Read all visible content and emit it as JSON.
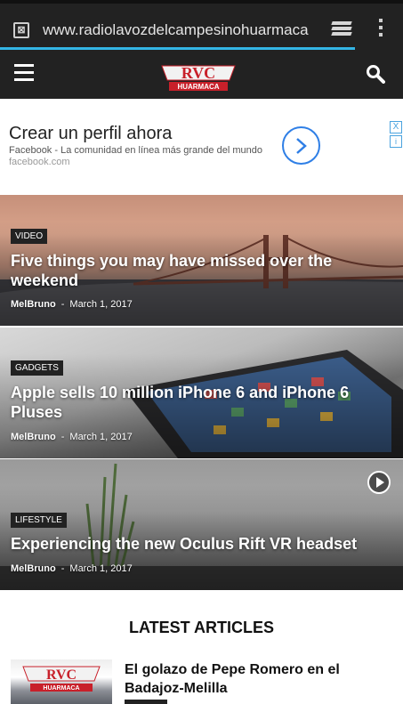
{
  "browser": {
    "url": "www.radiolavozdelcampesinohuarmaca",
    "page_load_progress": 0.88
  },
  "header": {
    "logo_text": "RVC",
    "logo_sub": "HUARMACA",
    "logo_color": "#c8202a"
  },
  "ad": {
    "title": "Crear un perfil ahora",
    "subtitle": "Facebook - La comunidad en línea más grande del mundo",
    "domain": "facebook.com",
    "close_label": "X",
    "info_label": "i",
    "accent_color": "#2f7fe6"
  },
  "posts": [
    {
      "category": "VIDEO",
      "title": "Five things you may have missed over the weekend",
      "author": "MelBruno",
      "date": "March 1, 2017"
    },
    {
      "category": "GADGETS",
      "title": "Apple sells 10 million iPhone 6 and iPhone 6 Pluses",
      "author": "MelBruno",
      "date": "March 1, 2017"
    },
    {
      "category": "LIFESTYLE",
      "title": "Experiencing the new Oculus Rift VR headset",
      "author": "MelBruno",
      "date": "March 1, 2017",
      "has_video": true
    }
  ],
  "latest": {
    "heading": "LATEST ARTICLES",
    "articles": [
      {
        "title": "El golazo de Pepe Romero en el Badajoz-Melilla"
      }
    ]
  }
}
